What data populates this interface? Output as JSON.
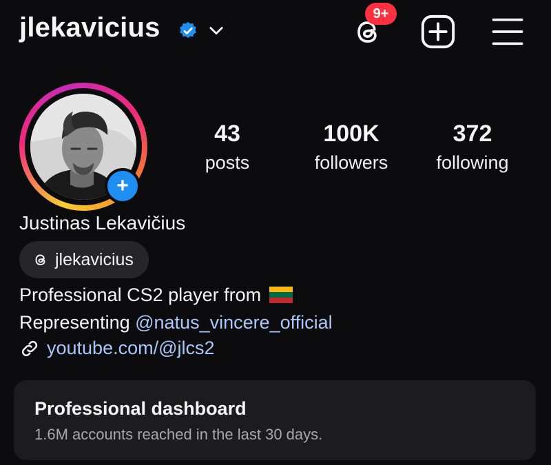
{
  "header": {
    "username": "jlekavicius",
    "verified_icon": "verified-badge-icon",
    "notification_badge": "9+",
    "icons": [
      "chevron-down-icon",
      "threads-icon",
      "add-square-icon",
      "hamburger-menu-icon"
    ]
  },
  "profile": {
    "full_name": "Justinas Lekavičius",
    "threads_handle": "jlekavicius",
    "stats": [
      {
        "value": "43",
        "label": "posts"
      },
      {
        "value": "100K",
        "label": "followers"
      },
      {
        "value": "372",
        "label": "following"
      }
    ],
    "bio_line1": "Professional CS2 player from",
    "bio_line2_prefix": "Representing ",
    "bio_mention": "@natus_vincere_official",
    "link": "youtube.com/@jlcs2"
  },
  "dashboard": {
    "title": "Professional dashboard",
    "subtitle": "1.6M accounts reached in the last 30 days."
  },
  "colors": {
    "background": "#0c0c0e",
    "accent_blue": "#1f8ef1",
    "link": "#a8c7fa",
    "badge_red": "#ff3040",
    "card": "#1c1c1e"
  }
}
